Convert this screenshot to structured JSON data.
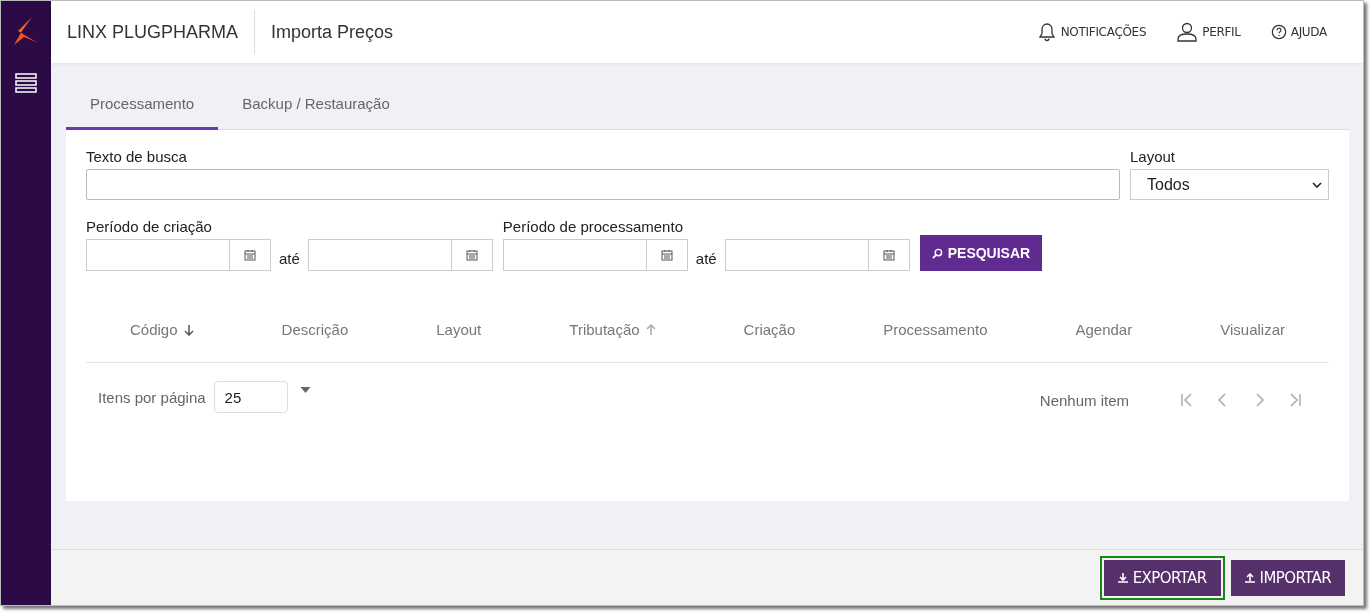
{
  "header": {
    "brand": "LINX PLUGPHARMA",
    "page_title": "Importa Preços",
    "actions": [
      {
        "kind": "bell",
        "label": "NOTIFICAÇÕES"
      },
      {
        "kind": "person",
        "label": "PERFIL"
      },
      {
        "kind": "help",
        "label": "AJUDA"
      }
    ]
  },
  "tabs": [
    {
      "label": "Processamento",
      "selected": true
    },
    {
      "label": "Backup / Restauração",
      "selected": false
    }
  ],
  "search": {
    "label": "Texto de busca"
  },
  "layout_select": {
    "label": "Layout",
    "value": "Todos"
  },
  "creation_period": {
    "label": "Período de criação",
    "separator": "até"
  },
  "processing_period": {
    "label": "Período de processamento",
    "separator": "até"
  },
  "search_button": "PESQUISAR",
  "table": {
    "columns": [
      {
        "label": "Código",
        "kind": "descending"
      },
      {
        "label": "Descrição",
        "kind": "plain"
      },
      {
        "label": "Layout",
        "kind": "plain"
      },
      {
        "label": "Tributação",
        "kind": "ascending"
      },
      {
        "label": "Criação",
        "kind": "plain"
      },
      {
        "label": "Processamento",
        "kind": "plain"
      },
      {
        "label": "Agendar",
        "kind": "plain"
      },
      {
        "label": "Visualizar",
        "kind": "plain"
      }
    ]
  },
  "pagination": {
    "items_label": "Itens por página",
    "page_size": "25",
    "status": "Nenhum item"
  },
  "footer_buttons": [
    {
      "kind": "export",
      "label": "EXPORTAR",
      "highlighted": true
    },
    {
      "kind": "import",
      "label": "IMPORTAR",
      "highlighted": false
    }
  ]
}
